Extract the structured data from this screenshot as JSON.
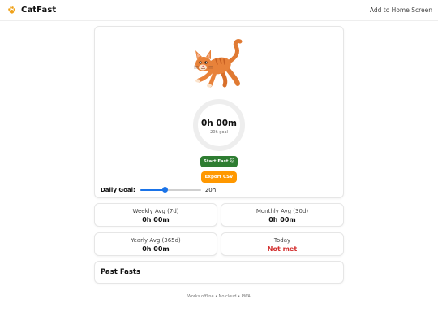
{
  "app": {
    "name": "CatFast",
    "add_to_home": "Add to Home Screen"
  },
  "timer": {
    "elapsed": "0h 00m",
    "goal_caption": "20h goal",
    "progress": 0
  },
  "buttons": {
    "start": "Start Fast 🐱",
    "export": "Export CSV"
  },
  "goal": {
    "label": "Daily Goal:",
    "value_text": "20h",
    "value": 20,
    "min": 1,
    "max": 48
  },
  "stats": {
    "weekly": {
      "label": "Weekly Avg (7d)",
      "value": "0h 00m"
    },
    "monthly": {
      "label": "Monthly Avg (30d)",
      "value": "0h 00m"
    },
    "yearly": {
      "label": "Yearly Avg (365d)",
      "value": "0h 00m"
    },
    "today": {
      "label": "Today",
      "value": "Not met"
    }
  },
  "past": {
    "title": "Past Fasts"
  },
  "footer": "Works offline • No cloud • PWA",
  "colors": {
    "start_button": "#2e7d32",
    "export_button": "#ff9800",
    "slider": "#1a73e8",
    "not_met": "#d32f2f",
    "ring_track": "#eeeeee",
    "cat": "#e8823a"
  },
  "icons": {
    "brand": "paw-icon",
    "mascot": "cat-illustration"
  }
}
